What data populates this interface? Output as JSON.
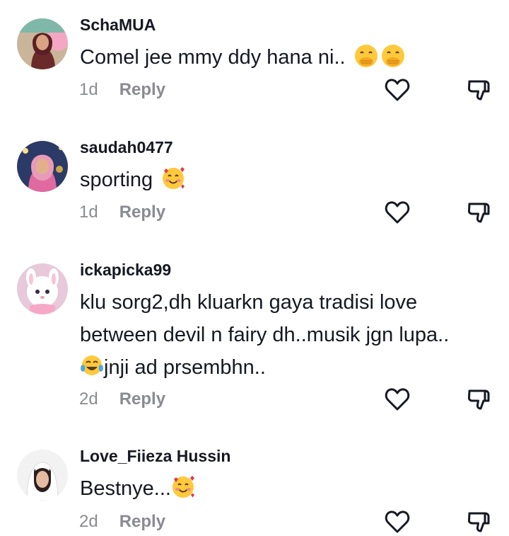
{
  "comments": [
    {
      "username": "SchaMUA",
      "lines": [
        "Comel jee mmy ddy hana ni.. "
      ],
      "emoji_after": [
        "hand-over-mouth-icon",
        "hand-over-mouth-icon"
      ],
      "time": "1d",
      "reply_label": "Reply"
    },
    {
      "username": "saudah0477",
      "lines": [
        "sporting "
      ],
      "emoji_after": [
        "smiling-face-with-hearts-icon"
      ],
      "time": "1d",
      "reply_label": "Reply"
    },
    {
      "username": "ickapicka99",
      "lines": [
        "klu sorg2,dh kluarkn gaya tradisi love",
        "between devil n fairy dh..musik jgn lupa..",
        "jnji ad prsembhn.."
      ],
      "emoji_before_line3": "tears-of-joy-icon",
      "time": "2d",
      "reply_label": "Reply"
    },
    {
      "username": "Love_Fiieza Hussin",
      "lines": [
        "Bestnye..."
      ],
      "emoji_after": [
        "smiling-face-with-hearts-icon"
      ],
      "time": "2d",
      "reply_label": "Reply"
    }
  ],
  "icons": {
    "like": "heart-outline-icon",
    "dislike": "thumbs-down-outline-icon"
  },
  "colors": {
    "text": "#161823",
    "meta": "#8a8b91",
    "icon": "#161823",
    "emoji_yellow": "#FFC93C",
    "heart": "#E5364B"
  }
}
